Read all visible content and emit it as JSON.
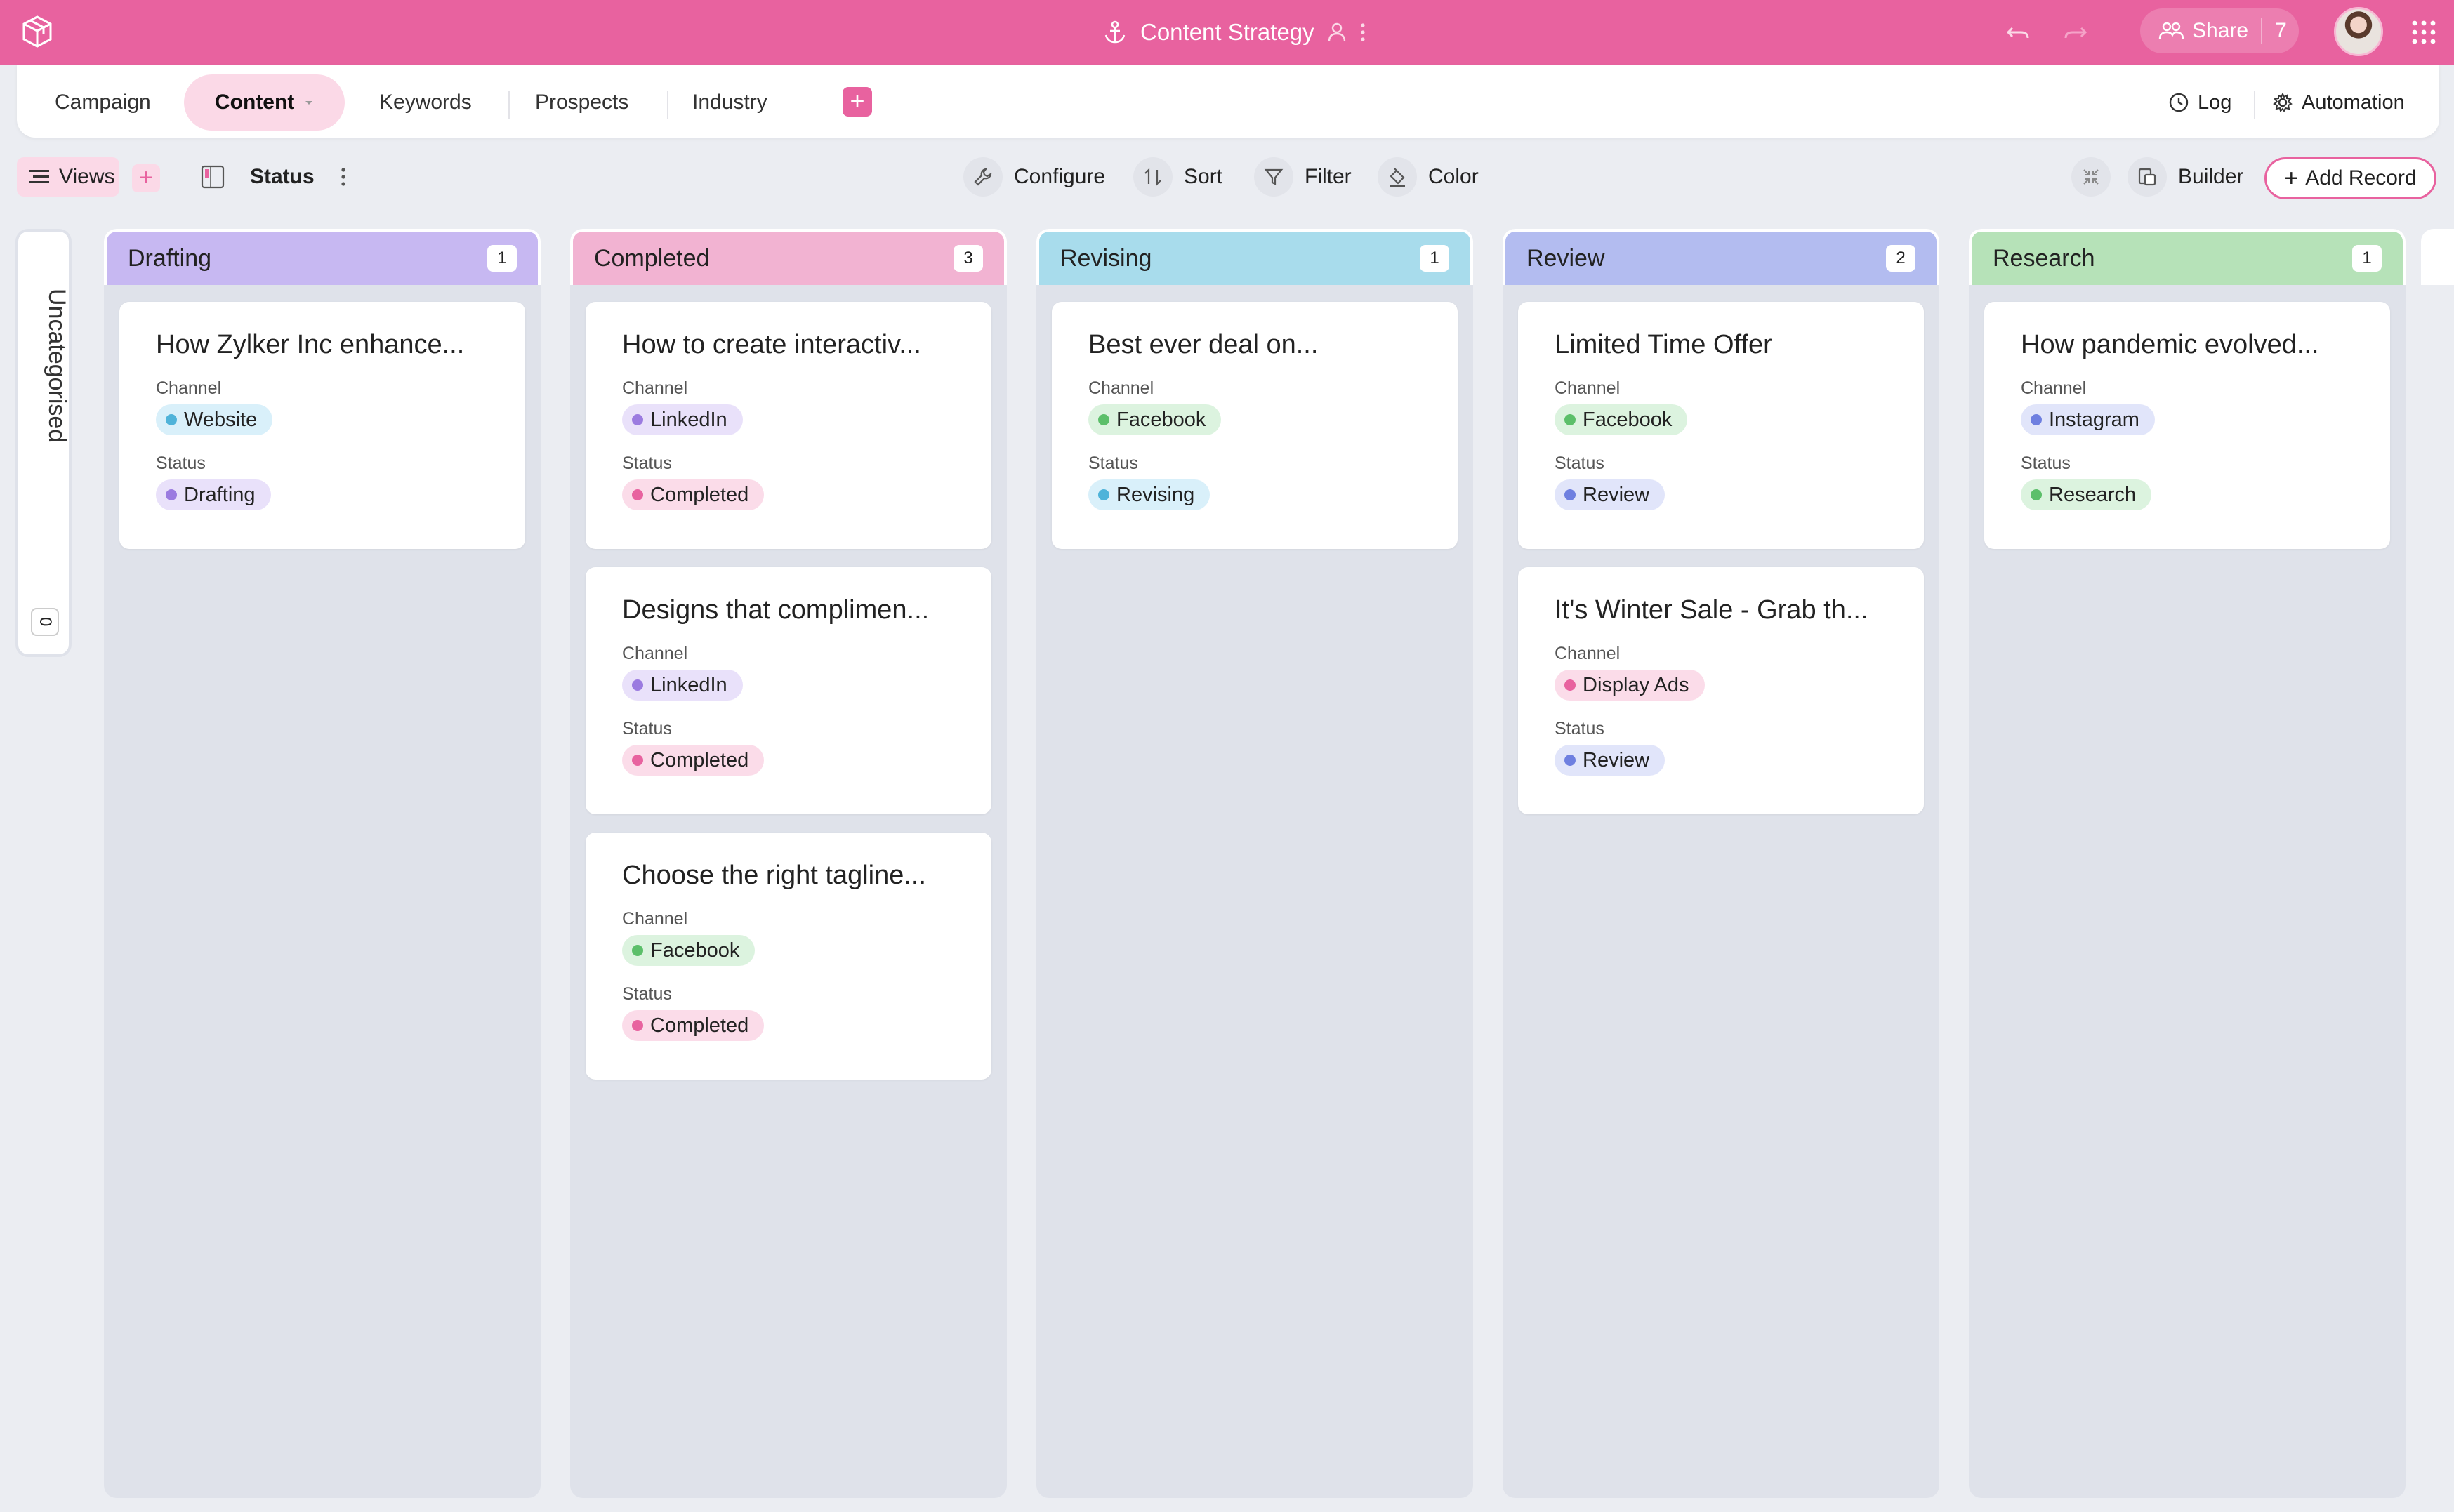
{
  "header": {
    "title": "Content Strategy",
    "share_label": "Share",
    "share_count": "7",
    "bg_color": "#e8629f"
  },
  "nav": {
    "tabs": [
      {
        "label": "Campaign",
        "active": false
      },
      {
        "label": "Content",
        "active": true
      },
      {
        "label": "Keywords",
        "active": false
      },
      {
        "label": "Prospects",
        "active": false
      },
      {
        "label": "Industry",
        "active": false
      }
    ],
    "add_tab_icon": "+",
    "log_label": "Log",
    "automation_label": "Automation"
  },
  "toolbar": {
    "views_label": "Views",
    "add_view_icon": "+",
    "view_name": "Status",
    "configure_label": "Configure",
    "sort_label": "Sort",
    "filter_label": "Filter",
    "color_label": "Color",
    "builder_label": "Builder",
    "add_record_label": "Add Record"
  },
  "uncategorised": {
    "label": "Uncategorised",
    "count": "0"
  },
  "field_labels": {
    "channel": "Channel",
    "status": "Status"
  },
  "columns": [
    {
      "title": "Drafting",
      "count": "1",
      "color": "#c7b8f2",
      "cards": [
        {
          "title": "How Zylker Inc enhance...",
          "channel": "Website",
          "channel_color": "#4fb3d9",
          "channel_bg": "#d9f0fa",
          "status": "Drafting",
          "status_color": "#9b7be0",
          "status_bg": "#e9e1fa"
        }
      ]
    },
    {
      "title": "Completed",
      "count": "3",
      "color": "#f2b3d2",
      "cards": [
        {
          "title": "How to create interactiv...",
          "channel": "LinkedIn",
          "channel_color": "#9b7be0",
          "channel_bg": "#e9e1fa",
          "status": "Completed",
          "status_color": "#e8629f",
          "status_bg": "#fbdce9"
        },
        {
          "title": "Designs that complimen...",
          "channel": "LinkedIn",
          "channel_color": "#9b7be0",
          "channel_bg": "#e9e1fa",
          "status": "Completed",
          "status_color": "#e8629f",
          "status_bg": "#fbdce9"
        },
        {
          "title": "Choose the right tagline...",
          "channel": "Facebook",
          "channel_color": "#5cbf6a",
          "channel_bg": "#dcf3df",
          "status": "Completed",
          "status_color": "#e8629f",
          "status_bg": "#fbdce9"
        }
      ]
    },
    {
      "title": "Revising",
      "count": "1",
      "color": "#a8dcec",
      "cards": [
        {
          "title": "Best ever deal on...",
          "channel": "Facebook",
          "channel_color": "#5cbf6a",
          "channel_bg": "#dcf3df",
          "status": "Revising",
          "status_color": "#4fb3d9",
          "status_bg": "#d9f0fa"
        }
      ]
    },
    {
      "title": "Review",
      "count": "2",
      "color": "#b3bcf0",
      "cards": [
        {
          "title": "Limited Time Offer",
          "channel": "Facebook",
          "channel_color": "#5cbf6a",
          "channel_bg": "#dcf3df",
          "status": "Review",
          "status_color": "#6e7fe0",
          "status_bg": "#e1e5fa"
        },
        {
          "title": "It's Winter Sale - Grab th...",
          "channel": "Display Ads",
          "channel_color": "#e8629f",
          "channel_bg": "#fbdce9",
          "status": "Review",
          "status_color": "#6e7fe0",
          "status_bg": "#e1e5fa"
        }
      ]
    },
    {
      "title": "Research",
      "count": "1",
      "color": "#b6e2b8",
      "cards": [
        {
          "title": "How pandemic evolved...",
          "channel": "Instagram",
          "channel_color": "#6e7fe0",
          "channel_bg": "#e1e5fa",
          "status": "Research",
          "status_color": "#5cbf6a",
          "status_bg": "#dcf3df"
        }
      ]
    }
  ]
}
